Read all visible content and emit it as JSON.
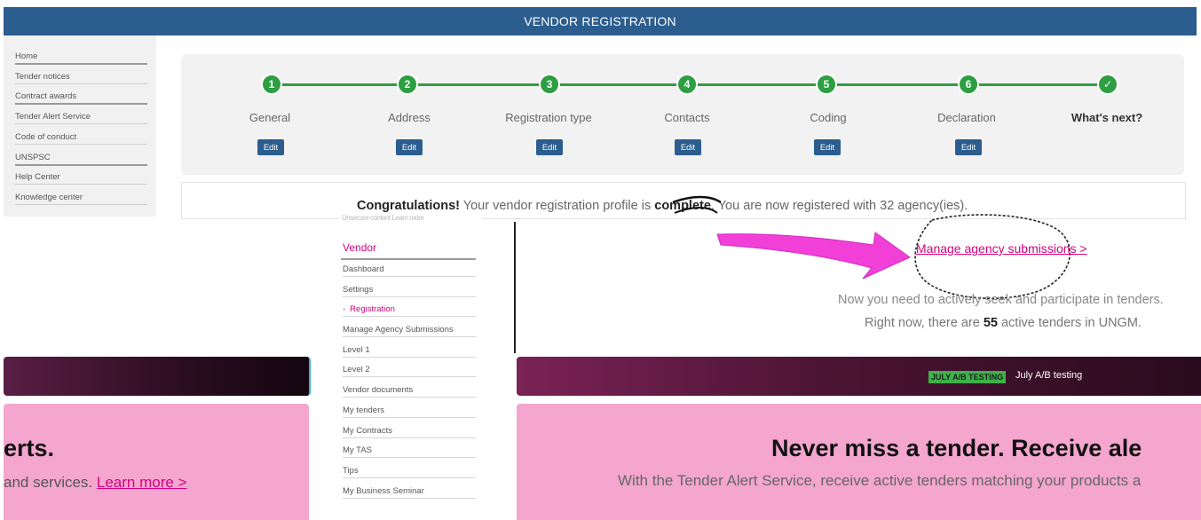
{
  "header": {
    "title": "VENDOR REGISTRATION"
  },
  "sidebar_top": {
    "items": [
      {
        "label": "Home"
      },
      {
        "label": "Tender notices"
      },
      {
        "label": "Contract awards"
      },
      {
        "label": "Tender Alert Service"
      },
      {
        "label": "Code of conduct"
      },
      {
        "label": "UNSPSC"
      },
      {
        "label": "Help Center"
      },
      {
        "label": "Knowledge center"
      }
    ]
  },
  "stepper": {
    "steps": [
      {
        "num": "1",
        "label": "General",
        "edit": "Edit"
      },
      {
        "num": "2",
        "label": "Address",
        "edit": "Edit"
      },
      {
        "num": "3",
        "label": "Registration type",
        "edit": "Edit"
      },
      {
        "num": "4",
        "label": "Contacts",
        "edit": "Edit"
      },
      {
        "num": "5",
        "label": "Coding",
        "edit": "Edit"
      },
      {
        "num": "6",
        "label": "Declaration",
        "edit": "Edit"
      },
      {
        "num": "✓",
        "label": "What's next?"
      }
    ]
  },
  "congrats": {
    "lead": "Congratulations!",
    "mid": " Your vendor registration profile is ",
    "bold": "complete",
    "tail": ". You are now registered with 32 agency(ies)."
  },
  "manage_link": "Manage agency submissions >",
  "now_text": "Now you need to actively seek and participate in tenders.",
  "active_tenders": {
    "pre": "Right now, there are ",
    "count": "55",
    "post": " active tenders in UNGM."
  },
  "vendor_sidebar": {
    "smear": "Unsecure content Learn more",
    "title": "Vendor",
    "items": [
      {
        "label": "Dashboard"
      },
      {
        "label": "Settings"
      },
      {
        "label": "Registration",
        "active": true
      },
      {
        "label": "Manage Agency Submissions"
      },
      {
        "label": "Level 1"
      },
      {
        "label": "Level 2"
      },
      {
        "label": "Vendor documents"
      },
      {
        "label": "My tenders"
      },
      {
        "label": "My Contracts"
      },
      {
        "label": "My TAS"
      },
      {
        "label": "Tips"
      },
      {
        "label": "My Business Seminar"
      }
    ]
  },
  "banner": {
    "badge": "JULY A/B TESTING",
    "text": "July A/B testing"
  },
  "promo_left": {
    "heading": "erts.",
    "text": "and services. ",
    "link": "Learn more >"
  },
  "promo_right": {
    "heading": "Never miss a tender. Receive ale",
    "text": "With the Tender Alert Service, receive active tenders matching your products a"
  },
  "colors": {
    "header": "#2b5d8e",
    "step_green": "#2e9e43",
    "accent_magenta": "#d4007f",
    "promo_pink": "#f4a6cf"
  }
}
